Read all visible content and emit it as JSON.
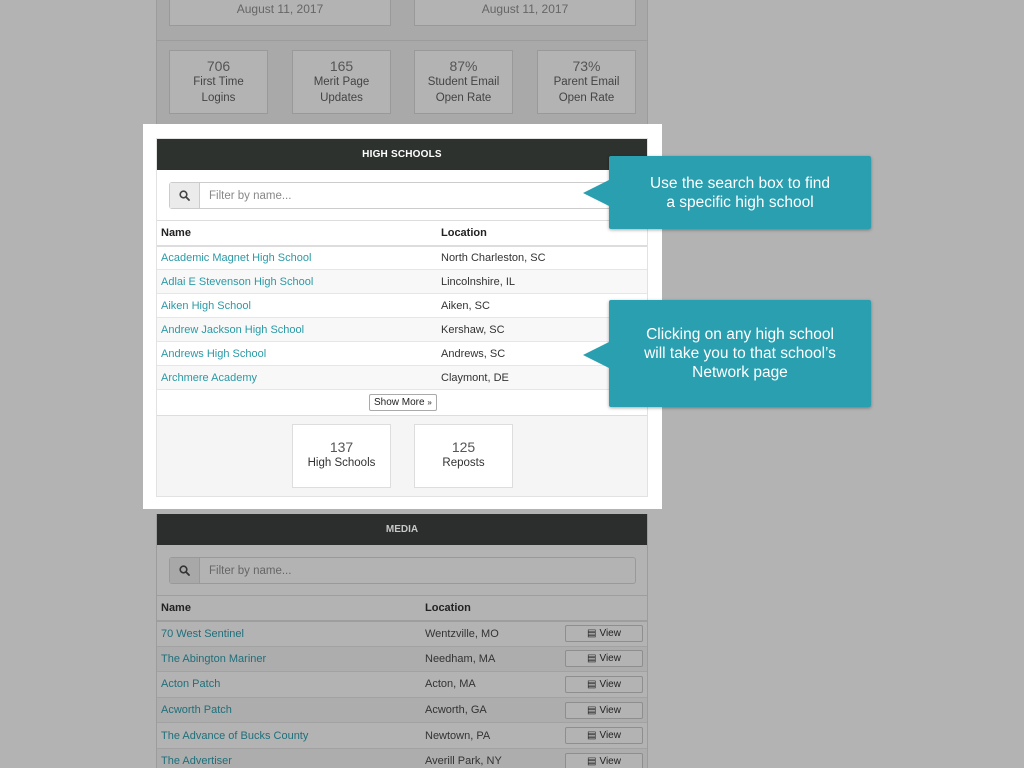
{
  "top": {
    "dates": [
      "August 11, 2017",
      "August 11, 2017"
    ],
    "stats": [
      {
        "value": "706",
        "label1": "First Time",
        "label2": "Logins"
      },
      {
        "value": "165",
        "label1": "Merit Page",
        "label2": "Updates"
      },
      {
        "value": "87%",
        "label1": "Student Email",
        "label2": "Open Rate"
      },
      {
        "value": "73%",
        "label1": "Parent Email",
        "label2": "Open Rate"
      }
    ]
  },
  "high_schools": {
    "title": "HIGH SCHOOLS",
    "search_placeholder": "Filter by name...",
    "col_name": "Name",
    "col_location": "Location",
    "rows": [
      {
        "name": "Academic Magnet High School",
        "location": "North Charleston, SC"
      },
      {
        "name": "Adlai E Stevenson High School",
        "location": "Lincolnshire, IL"
      },
      {
        "name": "Aiken High School",
        "location": "Aiken, SC"
      },
      {
        "name": "Andrew Jackson High School",
        "location": "Kershaw, SC"
      },
      {
        "name": "Andrews High School",
        "location": "Andrews, SC"
      },
      {
        "name": "Archmere Academy",
        "location": "Claymont, DE"
      }
    ],
    "show_more": "Show More",
    "cards": [
      {
        "value": "137",
        "label": "High Schools"
      },
      {
        "value": "125",
        "label": "Reposts"
      }
    ]
  },
  "callouts": {
    "search_tip_line1": "Use the search box to find",
    "search_tip_line2": "a specific high school",
    "click_tip_line1": "Clicking on any high school",
    "click_tip_line2": "will take you to that school’s",
    "click_tip_line3": "Network page"
  },
  "media": {
    "title": "MEDIA",
    "search_placeholder": "Filter by name...",
    "col_name": "Name",
    "col_location": "Location",
    "view_label": "View",
    "rows": [
      {
        "name": "70 West Sentinel",
        "location": "Wentzville, MO"
      },
      {
        "name": "The Abington Mariner",
        "location": "Needham, MA"
      },
      {
        "name": "Acton Patch",
        "location": "Acton, MA"
      },
      {
        "name": "Acworth Patch",
        "location": "Acworth, GA"
      },
      {
        "name": "The Advance of Bucks County",
        "location": "Newtown, PA"
      },
      {
        "name": "The Advertiser",
        "location": "Averill Park, NY"
      }
    ]
  },
  "colors": {
    "accent": "#2a9fb0",
    "link": "#2a9aa6",
    "header_bg": "#2e322f",
    "overlay": "#b3b3b3"
  },
  "icons": {
    "search": "search-icon",
    "view": "newspaper-icon",
    "show_more": "double-chevron-down-icon"
  }
}
